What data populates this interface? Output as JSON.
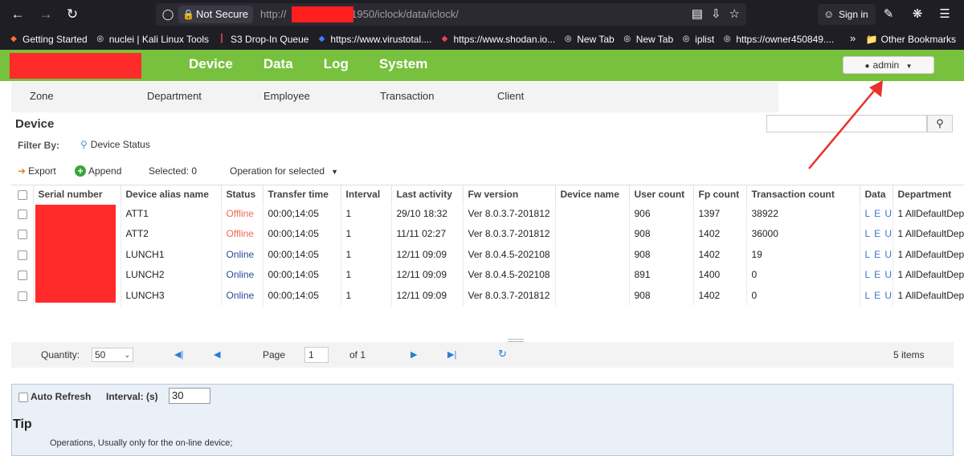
{
  "browser": {
    "not_secure": "Not Secure",
    "url_prefix": "http://",
    "url_suffix": ":1950/iclock/data/iclock/",
    "sign_in": "Sign in",
    "bookmarks": [
      {
        "label": "Getting Started",
        "icon": "firefox-icon",
        "color": "#ff7139"
      },
      {
        "label": "nuclei | Kali Linux Tools",
        "icon": "globe-icon",
        "color": "#fbfbfe"
      },
      {
        "label": "S3 Drop-In Queue",
        "icon": "bars-icon",
        "color": "#e5484d"
      },
      {
        "label": "https://www.virustotal....",
        "icon": "virustotal-icon",
        "color": "#3b82f6"
      },
      {
        "label": "https://www.shodan.io...",
        "icon": "shodan-icon",
        "color": "#e5484d"
      },
      {
        "label": "New Tab",
        "icon": "globe-icon",
        "color": "#fbfbfe"
      },
      {
        "label": "New Tab",
        "icon": "globe-icon",
        "color": "#fbfbfe"
      },
      {
        "label": "iplist",
        "icon": "globe-icon",
        "color": "#fbfbfe"
      },
      {
        "label": "https://owner450849....",
        "icon": "globe-icon",
        "color": "#fbfbfe"
      }
    ],
    "other_bookmarks": "Other Bookmarks"
  },
  "app": {
    "nav": [
      "Device",
      "Data",
      "Log",
      "System"
    ],
    "user": "admin",
    "subnav": [
      "Zone",
      "Department",
      "Employee",
      "Transaction",
      "Client"
    ]
  },
  "device": {
    "title": "Device",
    "filter_by": "Filter By:",
    "device_status": "Device Status",
    "export": "Export",
    "append": "Append",
    "selected": "Selected: 0",
    "operation": "Operation for selected"
  },
  "table": {
    "columns": [
      "Serial number",
      "Device alias name",
      "Status",
      "Transfer time",
      "Interval",
      "Last activity",
      "Fw version",
      "Device name",
      "User count",
      "Fp count",
      "Transaction count",
      "Data",
      "Department"
    ],
    "rows": [
      {
        "alias": "ATT1",
        "status": "Offline",
        "transfer": "00:00;14:05",
        "interval": "1",
        "last": "29/10 18:32",
        "fw": "Ver 8.0.3.7-201812",
        "devname": "",
        "users": "906",
        "fp": "1397",
        "tx": "38922",
        "data": "L E U",
        "dept": "1 AllDefaultDep"
      },
      {
        "alias": "ATT2",
        "status": "Offline",
        "transfer": "00:00;14:05",
        "interval": "1",
        "last": "11/11 02:27",
        "fw": "Ver 8.0.3.7-201812",
        "devname": "",
        "users": "908",
        "fp": "1402",
        "tx": "36000",
        "data": "L E U",
        "dept": "1 AllDefaultDep"
      },
      {
        "alias": "LUNCH1",
        "status": "Online",
        "transfer": "00:00;14:05",
        "interval": "1",
        "last": "12/11 09:09",
        "fw": "Ver 8.0.4.5-202108",
        "devname": "",
        "users": "908",
        "fp": "1402",
        "tx": "19",
        "data": "L E U",
        "dept": "1 AllDefaultDep"
      },
      {
        "alias": "LUNCH2",
        "status": "Online",
        "transfer": "00:00;14:05",
        "interval": "1",
        "last": "12/11 09:09",
        "fw": "Ver 8.0.4.5-202108",
        "devname": "",
        "users": "891",
        "fp": "1400",
        "tx": "0",
        "data": "L E U",
        "dept": "1 AllDefaultDep"
      },
      {
        "alias": "LUNCH3",
        "status": "Online",
        "transfer": "00:00;14:05",
        "interval": "1",
        "last": "12/11 09:09",
        "fw": "Ver 8.0.3.7-201812",
        "devname": "",
        "users": "908",
        "fp": "1402",
        "tx": "0",
        "data": "L E U",
        "dept": "1 AllDefaultDep"
      }
    ]
  },
  "pager": {
    "quantity_label": "Quantity:",
    "quantity": "50",
    "page_label": "Page",
    "page": "1",
    "of": "of 1",
    "items": "5 items"
  },
  "bottom": {
    "auto_refresh": "Auto Refresh",
    "interval_label": "Interval: (s)",
    "interval_value": "30",
    "tip_title": "Tip",
    "tip_text": "Operations, Usually only for the on-line device;"
  },
  "colors": {
    "app_green": "#78c13e",
    "offline": "#ee6a57",
    "online": "#2a4a9a",
    "annotation_arrow": "#e8322c",
    "redaction": "#ff2a2a"
  }
}
